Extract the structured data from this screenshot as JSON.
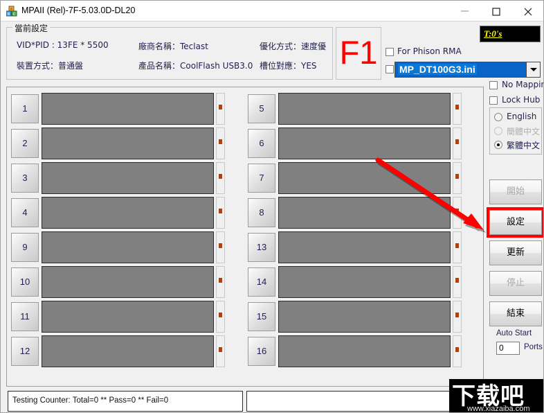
{
  "window": {
    "title": "MPAII (Rel)-7F-5.03.0D-DL20",
    "icon": "abc-blocks-icon",
    "minimize_label": "–",
    "maximize_label": "□",
    "close_label": "×"
  },
  "settings_group": {
    "legend": "當前設定",
    "rows": [
      {
        "col1": "VID*PID : 13FE * 5500",
        "col2": "廠商名稱：Teclast",
        "col3": "優化方式：速度優"
      },
      {
        "col1": "裝置方式：普通盤",
        "col2": "產品名稱：CoolFlash USB3.0",
        "col3": "槽位對應：YES"
      }
    ]
  },
  "f1_box": {
    "label": "F1",
    "color": "#ff0000"
  },
  "timer_badge": {
    "text": "T:0's",
    "fg": "#ffff00",
    "bg": "#000000"
  },
  "options": {
    "phison_rma": {
      "label": "For Phison RMA",
      "checked": false
    },
    "ini_checkbox": {
      "checked": false
    },
    "ini_select": {
      "value": "MP_DT100G3.ini",
      "arrow_icon": "chevron-down-icon",
      "highlight": "#0a78d4"
    },
    "no_mapping": {
      "label": "No Mapping",
      "checked": false
    },
    "lock_hub": {
      "label": "Lock Hub",
      "checked": false
    }
  },
  "language": {
    "options": [
      {
        "label": "English",
        "selected": false,
        "disabled": false
      },
      {
        "label": "簡體中文",
        "selected": false,
        "disabled": true
      },
      {
        "label": "繁體中文",
        "selected": true,
        "disabled": false
      }
    ]
  },
  "actions": {
    "start": {
      "label": "開始",
      "enabled": false,
      "highlighted": false
    },
    "settings": {
      "label": "設定",
      "enabled": true,
      "highlighted": true,
      "highlight_color": "#ff0000"
    },
    "update": {
      "label": "更新",
      "enabled": true,
      "highlighted": false
    },
    "stop": {
      "label": "停止",
      "enabled": false,
      "highlighted": false
    },
    "exit": {
      "label": "結束",
      "enabled": true,
      "highlighted": false
    }
  },
  "auto_start": {
    "label": "Auto Start",
    "value": "0",
    "unit": "Ports"
  },
  "slots": {
    "column_a": [
      "1",
      "2",
      "3",
      "4",
      "9",
      "10",
      "11",
      "12"
    ],
    "column_b": [
      "5",
      "6",
      "7",
      "8",
      "13",
      "14",
      "15",
      "16"
    ],
    "bar_color": "#808080"
  },
  "status": {
    "left": "Testing Counter: Total=0 ** Pass=0 ** Fail=0",
    "right": ""
  },
  "annotation": {
    "arrow_color": "#ff0000"
  },
  "watermark": {
    "text": "下载吧",
    "url": "www.xiazaiba.com"
  }
}
